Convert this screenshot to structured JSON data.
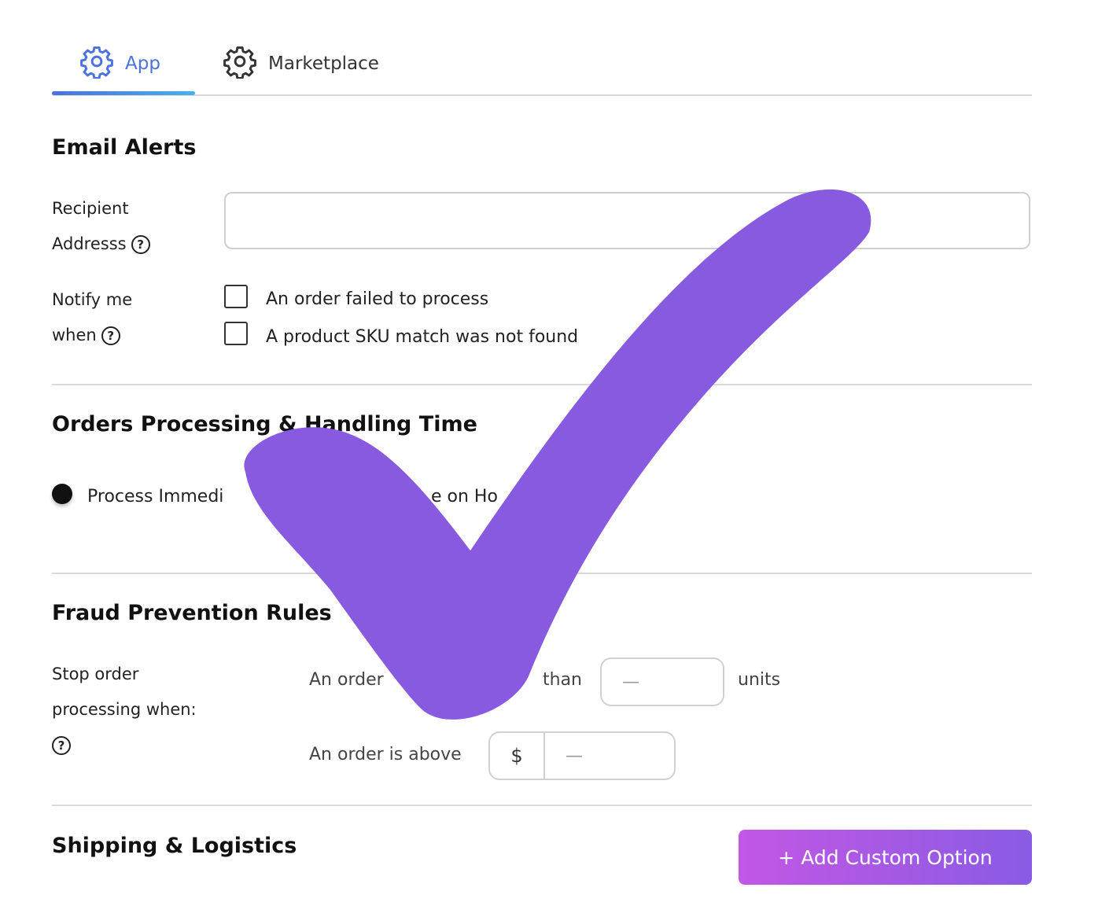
{
  "tabs": [
    {
      "label": "App",
      "icon": "gear-icon",
      "active": true
    },
    {
      "label": "Marketplace",
      "icon": "gear-icon",
      "active": false
    }
  ],
  "email_alerts": {
    "title": "Email Alerts",
    "recipient_label_line1": "Recipient",
    "recipient_label_line2": "Addresss",
    "recipient_value": "",
    "notify_label_line1": "Notify me",
    "notify_label_line2": "when",
    "options": [
      {
        "label": "An order failed to process",
        "checked": false
      },
      {
        "label": "A product SKU match was not found",
        "checked": false
      }
    ]
  },
  "orders_processing": {
    "title": "Orders Processing & Handling Time",
    "radio_options": [
      {
        "label": "Process Immedi",
        "selected": true
      },
      {
        "label": "e on Ho",
        "selected": false
      }
    ]
  },
  "fraud": {
    "title": "Fraud Prevention Rules",
    "stop_label_line1": "Stop order",
    "stop_label_line2": "processing when:",
    "rule1_prefix": "An order",
    "rule1_suffix_partial": "than",
    "rule1_value": "—",
    "rule1_unit": "units",
    "rule2_prefix": "An order is above",
    "rule2_currency": "$",
    "rule2_value": "—"
  },
  "shipping": {
    "title": "Shipping & Logistics",
    "add_button": "+ Add Custom Option"
  },
  "help_glyph": "?",
  "colors": {
    "accent_blue": "#4a72e0",
    "checkmark_purple": "#875ae0",
    "button_gradient_start": "#c257e4",
    "button_gradient_end": "#8a5be4"
  }
}
